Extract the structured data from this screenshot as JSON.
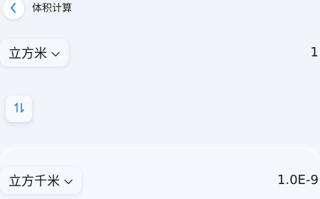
{
  "header": {
    "title": "体积计算"
  },
  "from_unit": {
    "label": "立方米",
    "value": "1"
  },
  "to_unit": {
    "label": "立方千米",
    "value": "1.0E-9"
  },
  "icons": {
    "back": "chevron-left-icon",
    "swap": "swap-vertical-icon",
    "dropdown": "chevron-down-icon"
  },
  "colors": {
    "accent": "#1e88e5",
    "background": "#f2f4fb"
  }
}
